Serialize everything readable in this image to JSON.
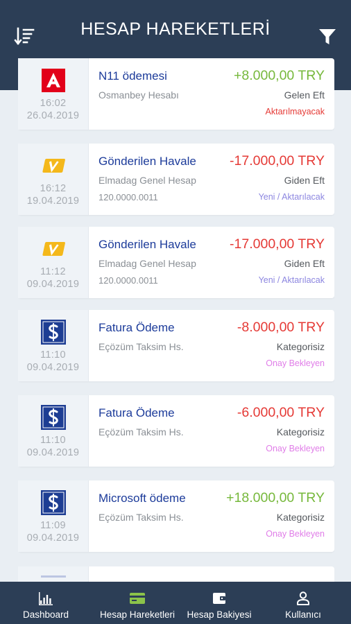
{
  "header": {
    "title": "HESAP HAREKETLERİ",
    "sort_icon": "sort-descending-icon",
    "filter_icon": "filter-icon"
  },
  "transactions": [
    {
      "logo": "akbank-logo",
      "time": "16:02",
      "date": "26.04.2019",
      "title": "N11 ödemesi",
      "account": "Osmanbey Hesabı",
      "iban": "",
      "amount": "+8.000,00 TRY",
      "type": "Gelen Eft",
      "status": "Aktarılmayacak",
      "status_color": "#e53935"
    },
    {
      "logo": "vakifbank-logo",
      "time": "16:12",
      "date": "19.04.2019",
      "title": "Gönderilen Havale",
      "account": "Elmadag Genel Hesap",
      "iban": "120.0000.0011",
      "amount": "-17.000,00 TRY",
      "type": "Giden Eft",
      "status": "Yeni / Aktarılacak",
      "status_color": "#8c86e0"
    },
    {
      "logo": "vakifbank-logo",
      "time": "11:12",
      "date": "09.04.2019",
      "title": "Gönderilen Havale",
      "account": "Elmadag Genel Hesap",
      "iban": "120.0000.0011",
      "amount": "-17.000,00 TRY",
      "type": "Giden Eft",
      "status": "Yeni / Aktarılacak",
      "status_color": "#8c86e0"
    },
    {
      "logo": "isbank-logo",
      "time": "11:10",
      "date": "09.04.2019",
      "title": "Fatura Ödeme",
      "account": "Eçözüm Taksim Hs.",
      "iban": "",
      "amount": "-8.000,00 TRY",
      "type": "Kategorisiz",
      "status": "Onay Bekleyen",
      "status_color": "#e07de8"
    },
    {
      "logo": "isbank-logo",
      "time": "11:10",
      "date": "09.04.2019",
      "title": "Fatura Ödeme",
      "account": "Eçözüm Taksim Hs.",
      "iban": "",
      "amount": "-6.000,00 TRY",
      "type": "Kategorisiz",
      "status": "Onay Bekleyen",
      "status_color": "#e07de8"
    },
    {
      "logo": "isbank-logo",
      "time": "11:09",
      "date": "09.04.2019",
      "title": "Microsoft ödeme",
      "account": "Eçözüm Taksim Hs.",
      "iban": "",
      "amount": "+18.000,00 TRY",
      "type": "Kategorisiz",
      "status": "Onay Bekleyen",
      "status_color": "#e07de8"
    }
  ],
  "nav": [
    {
      "label": "Dashboard",
      "icon": "bar-chart-icon",
      "active": false
    },
    {
      "label": "Hesap Hareketleri",
      "icon": "credit-card-icon",
      "active": true
    },
    {
      "label": "Hesap Bakiyesi",
      "icon": "wallet-icon",
      "active": false
    },
    {
      "label": "Kullanıcı",
      "icon": "user-icon",
      "active": false
    }
  ],
  "colors": {
    "header_bg": "#2c3e56",
    "positive": "#76b83b",
    "negative": "#e53935",
    "title_blue": "#1c3b9a",
    "active_nav": "#8bc34a"
  }
}
